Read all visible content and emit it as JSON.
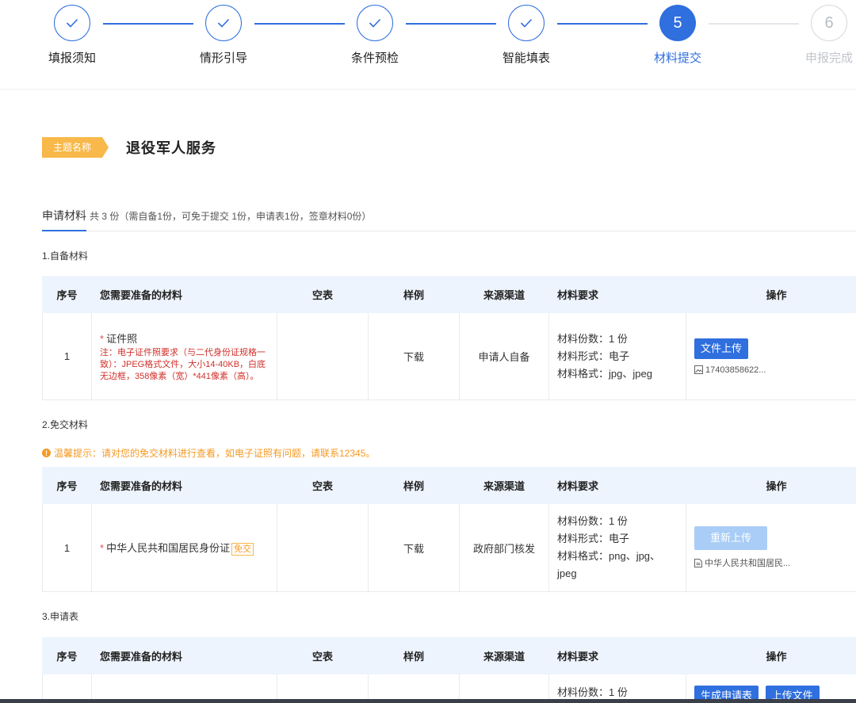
{
  "stepper": {
    "steps": [
      {
        "label": "填报须知",
        "state": "done",
        "num": ""
      },
      {
        "label": "情形引导",
        "state": "done",
        "num": ""
      },
      {
        "label": "条件预检",
        "state": "done",
        "num": ""
      },
      {
        "label": "智能填表",
        "state": "done",
        "num": ""
      },
      {
        "label": "材料提交",
        "state": "active",
        "num": "5"
      },
      {
        "label": "申报完成",
        "state": "todo",
        "num": "6"
      }
    ]
  },
  "theme": {
    "badge": "主题名称",
    "name": "退役军人服务"
  },
  "summary": {
    "title": "申请材料",
    "detail": "共 3 份（需自备1份，可免于提交 1份，申请表1份，签章材料0份）"
  },
  "headers": {
    "no": "序号",
    "material": "您需要准备的材料",
    "blank": "空表",
    "sample": "样例",
    "source": "来源渠道",
    "requirement": "材料要求",
    "operation": "操作"
  },
  "sections": {
    "self": {
      "title": "1.自备材料",
      "row": {
        "no": "1",
        "name": "证件照",
        "note": "注：电子证件照要求（与二代身份证规格一致）：JPEG格式文件，大小14-40KB，白底无边框，358像素（宽）*441像素（高）。",
        "sample": "下载",
        "source": "申请人自备",
        "req1": "材料份数：1 份",
        "req2": "材料形式：电子",
        "req3": "材料格式：jpg、jpeg",
        "button": "文件上传",
        "file": "17403858622..."
      }
    },
    "exempt": {
      "title": "2.免交材料",
      "tip": "温馨提示：请对您的免交材料进行查看，如电子证照有问题，请联系12345。",
      "row": {
        "no": "1",
        "name": "中华人民共和国居民身份证",
        "badge": "免交",
        "sample": "下载",
        "source": "政府部门核发",
        "req1": "材料份数：1 份",
        "req2": "材料形式：电子",
        "req3": "材料格式：png、jpg、jpeg",
        "button": "重新上传",
        "file": "中华人民共和国居民..."
      }
    },
    "form": {
      "title": "3.申请表",
      "row": {
        "req1": "材料份数：1 份",
        "button1": "生成申请表",
        "button2": "上传文件"
      }
    }
  }
}
